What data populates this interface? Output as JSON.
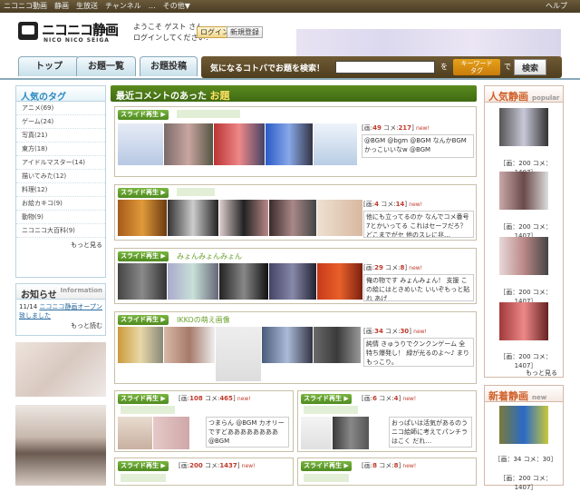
{
  "topbar": {
    "links": [
      "ニコニコ動画",
      "静画",
      "生放送",
      "チャンネル",
      "…",
      "その他▼"
    ],
    "help": "ヘルプ"
  },
  "logo": {
    "name": "ニコニコ静画",
    "sub": "NICO NICO SEIGA"
  },
  "header": {
    "welcome_line1": "ようこそ ゲスト さん",
    "welcome_line2": "ログインしてください！",
    "login": "ログイン",
    "register": "新規登録"
  },
  "nav": {
    "tabs": [
      "トップ",
      "お題一覧",
      "お題投稿"
    ],
    "search_label": "気になるコトバでお題を検索！",
    "search_placeholder": "",
    "wo": "を",
    "keyword_top": "キーワード",
    "keyword_bottom": "タグ",
    "de": "で",
    "search_button": "検索"
  },
  "tags": {
    "title": "人気のタグ",
    "items": [
      "アニメ(69)",
      "ゲーム(24)",
      "写真(21)",
      "東方(18)",
      "アイドルマスター(14)",
      "描いてみた(12)",
      "料理(12)",
      "お絵カキコ(9)",
      "動物(9)",
      "ニコニコ大百科(9)"
    ],
    "more": "もっと見る"
  },
  "notice": {
    "title": "お知らせ",
    "title_en": "Information",
    "date": "11/14",
    "text": "ニコニコ静画オープン致しました",
    "more": "もっと読む"
  },
  "main": {
    "header_prefix": "最近コメントのあった",
    "header_strong": "お題",
    "slide": "スライド再生 ▶",
    "cards": [
      {
        "title": "",
        "images": "49",
        "comments": "217",
        "new": "new!",
        "comment": "@BGM @bgm @BGM なんかBGMかっこいいなw @BGM"
      },
      {
        "title": "",
        "images": "4",
        "comments": "14",
        "new": "new!",
        "comment": "他にも立ってるのか なんでコメ番号7とかいってる これはセーフだろ？どこまでがセ 他のスレに兆…"
      },
      {
        "title": "みょんみょんみょん",
        "images": "29",
        "comments": "8",
        "new": "new!",
        "comment": "俺の物です みょんみょん！ 支援 この絵にはときめいた いいぞもっと貼れ あげ"
      },
      {
        "title": "IKKOの萌え画像",
        "images": "34",
        "comments": "30",
        "new": "new!",
        "comment": "純情 きゅうりでクンクンゲーム 全特ち爆発し！ 緑が光るのよ～♪ まりもっこり。"
      },
      {
        "title": "",
        "images": "108",
        "comments": "465",
        "new": "new!",
        "comment": "つまらん @BGM カオリー ですどああああああああ @BGM"
      },
      {
        "title": "",
        "images": "6",
        "comments": "4",
        "new": "new!",
        "comment": "おっぱいは活気があるのう ニコ絵師に考えてパンチラはこく だれ…"
      },
      {
        "title": "",
        "images": "200",
        "comments": "1437",
        "new": "new!"
      },
      {
        "title": "",
        "images": "8",
        "comments": "8",
        "new": "new!"
      }
    ],
    "img_label": "画",
    "com_label": "コメ"
  },
  "popular": {
    "title": "人気静画",
    "title_en": "popular",
    "items": [
      "［画：200 コメ：1407］",
      "［画：200 コメ：1407］",
      "［画：200 コメ：1407］",
      "［画：200 コメ：1407］"
    ],
    "more": "もっと見る"
  },
  "newest": {
    "title": "新着静画",
    "title_en": "new",
    "items": [
      "［画：34 コメ：30］",
      "［画：200 コメ：1407］"
    ]
  }
}
